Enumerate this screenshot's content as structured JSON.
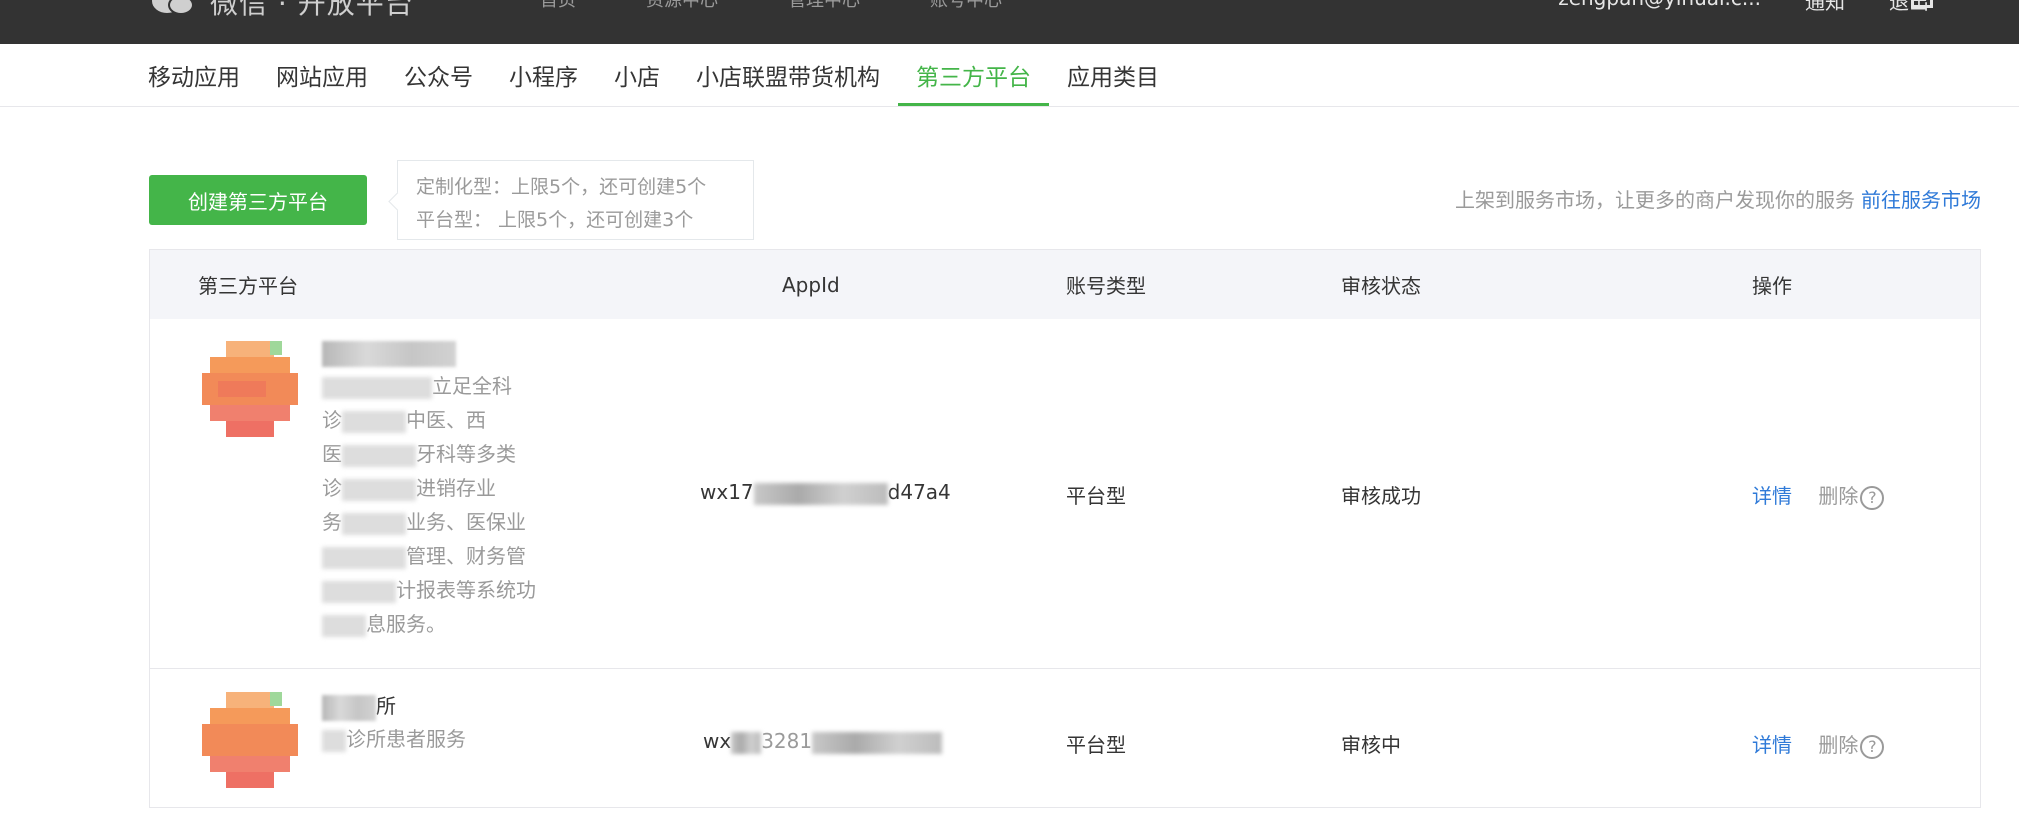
{
  "topbar": {
    "logo_text": "微信 · 开放平台",
    "nav": [
      "首页",
      "资源中心",
      "管理中心",
      "账号中心"
    ],
    "user_email": "zengpan@yihuai.c...",
    "notify_label": "通知",
    "logout_label": "退出"
  },
  "tabs": [
    "移动应用",
    "网站应用",
    "公众号",
    "小程序",
    "小店",
    "小店联盟带货机构",
    "第三方平台",
    "应用类目"
  ],
  "active_tab": "第三方平台",
  "create_button": "创建第三方平台",
  "quota": {
    "line1": "定制化型：上限5个，还可创建5个",
    "line2": "平台型： 上限5个，还可创建3个"
  },
  "market": {
    "text": "上架到服务市场，让更多的商户发现你的服务",
    "link": "前往服务市场"
  },
  "table": {
    "headers": {
      "platform": "第三方平台",
      "appid": "AppId",
      "account_type": "账号类型",
      "review_status": "审核状态",
      "actions": "操作"
    },
    "rows": [
      {
        "desc_lines": [
          {
            "pre": "",
            "vis": "立足全科"
          },
          {
            "pre": "诊",
            "vis": "中医、西"
          },
          {
            "pre": "医",
            "vis": "牙科等多类"
          },
          {
            "pre": "诊",
            "vis": "进销存业"
          },
          {
            "pre": "务",
            "vis": "业务、医保业"
          },
          {
            "pre": "",
            "vis": "管理、财务管"
          },
          {
            "pre": "",
            "vis": "计报表等系统功"
          },
          {
            "pre": "",
            "vis": "息服务。"
          }
        ],
        "appid_prefix": "wx17",
        "appid_suffix": "d47a4",
        "account_type": "平台型",
        "review_status": "审核成功",
        "detail_label": "详情",
        "delete_label": "删除"
      },
      {
        "name_suffix": "所",
        "desc_suffix": "诊所患者服务",
        "appid_prefix": "wx",
        "appid_mid": "3281",
        "account_type": "平台型",
        "review_status": "审核中",
        "detail_label": "详情",
        "delete_label": "删除"
      }
    ]
  },
  "help_glyph": "?",
  "colors": {
    "topbar": "#333333",
    "accent_green": "#44b549",
    "link_blue": "#2f7ad8",
    "table_header_bg": "#f4f5f9"
  }
}
